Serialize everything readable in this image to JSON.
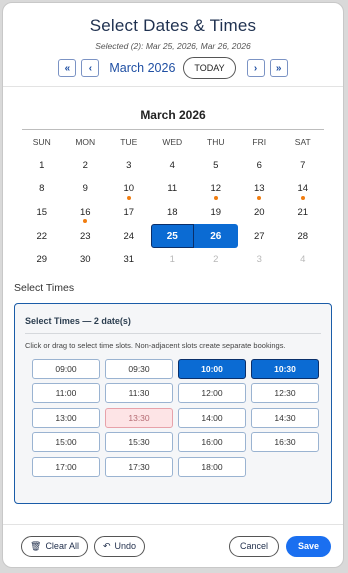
{
  "header": {
    "title": "Select Dates & Times",
    "subtitle": "Selected (2): Mar 25, 2026, Mar 26, 2026",
    "nav": {
      "prev_year": "«",
      "prev_month": "‹",
      "month_label": "March 2026",
      "today": "TODAY",
      "next_month": "›",
      "next_year": "»"
    }
  },
  "calendar": {
    "title": "March 2026",
    "weekdays": [
      "SUN",
      "MON",
      "TUE",
      "WED",
      "THU",
      "FRI",
      "SAT"
    ],
    "weeks": [
      [
        {
          "d": "1"
        },
        {
          "d": "2"
        },
        {
          "d": "3"
        },
        {
          "d": "4"
        },
        {
          "d": "5"
        },
        {
          "d": "6"
        },
        {
          "d": "7"
        }
      ],
      [
        {
          "d": "8"
        },
        {
          "d": "9"
        },
        {
          "d": "10",
          "dot": true
        },
        {
          "d": "11"
        },
        {
          "d": "12",
          "dot": true
        },
        {
          "d": "13",
          "dot": true
        },
        {
          "d": "14",
          "dot": true
        }
      ],
      [
        {
          "d": "15"
        },
        {
          "d": "16",
          "dot": true
        },
        {
          "d": "17"
        },
        {
          "d": "18"
        },
        {
          "d": "19"
        },
        {
          "d": "20"
        },
        {
          "d": "21"
        }
      ],
      [
        {
          "d": "22"
        },
        {
          "d": "23"
        },
        {
          "d": "24"
        },
        {
          "d": "25",
          "selected": "left"
        },
        {
          "d": "26",
          "selected": "right"
        },
        {
          "d": "27"
        },
        {
          "d": "28"
        }
      ],
      [
        {
          "d": "29"
        },
        {
          "d": "30"
        },
        {
          "d": "31"
        },
        {
          "d": "1",
          "muted": true
        },
        {
          "d": "2",
          "muted": true
        },
        {
          "d": "3",
          "muted": true
        },
        {
          "d": "4",
          "muted": true
        }
      ]
    ],
    "colors": {
      "selected": "#0b6bd3",
      "event_dot": "#f07d10"
    }
  },
  "times": {
    "label": "Select Times",
    "panel_title": "Select Times — 2 date(s)",
    "hint": "Click or drag to select time slots. Non-adjacent slots create separate bookings.",
    "slots": [
      {
        "t": "09:00"
      },
      {
        "t": "09:30"
      },
      {
        "t": "10:00",
        "state": "selected"
      },
      {
        "t": "10:30",
        "state": "selected"
      },
      {
        "t": "11:00"
      },
      {
        "t": "11:30"
      },
      {
        "t": "12:00"
      },
      {
        "t": "12:30"
      },
      {
        "t": "13:00"
      },
      {
        "t": "13:30",
        "state": "booked"
      },
      {
        "t": "14:00"
      },
      {
        "t": "14:30"
      },
      {
        "t": "15:00"
      },
      {
        "t": "15:30"
      },
      {
        "t": "16:00"
      },
      {
        "t": "16:30"
      },
      {
        "t": "17:00"
      },
      {
        "t": "17:30"
      },
      {
        "t": "18:00"
      }
    ]
  },
  "footer": {
    "clear_all": "Clear All",
    "undo": "Undo",
    "cancel": "Cancel",
    "save": "Save",
    "icons": {
      "clear_all": "trash-icon",
      "undo": "undo-icon"
    }
  }
}
